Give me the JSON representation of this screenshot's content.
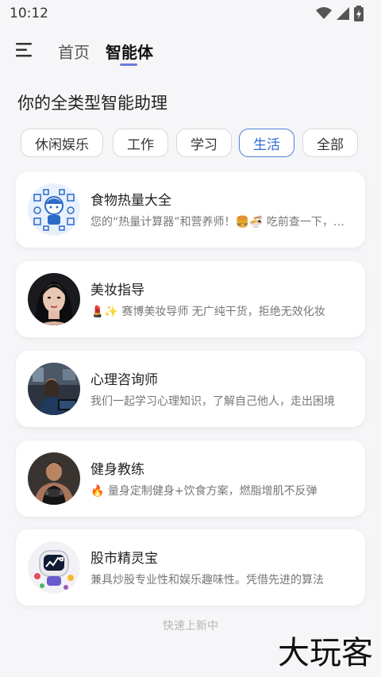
{
  "status_bar": {
    "time": "10:12"
  },
  "nav": {
    "tabs": [
      {
        "label": "首页"
      },
      {
        "label": "智能体"
      }
    ]
  },
  "headline": "你的全类型智能助理",
  "chips": [
    {
      "label": "休闲娱乐",
      "active": false
    },
    {
      "label": "工作",
      "active": false
    },
    {
      "label": "学习",
      "active": false
    },
    {
      "label": "生活",
      "active": true
    },
    {
      "label": "全部",
      "active": false
    }
  ],
  "cards": [
    {
      "title": "食物热量大全",
      "desc": "您的“热量计算器”和营养师！🍔🍜 吃前查一下，吃得更健康",
      "avatar_icon": "food-illustration-icon"
    },
    {
      "title": "美妆指导",
      "desc": "💄✨ 赛博美妆导师 无广纯干货，拒绝无效化妆",
      "avatar_icon": "woman-portrait-icon"
    },
    {
      "title": "心理咨询师",
      "desc": "我们一起学习心理知识，了解自己他人，走出困境",
      "avatar_icon": "therapist-portrait-icon"
    },
    {
      "title": "健身教练",
      "desc": "🔥 量身定制健身+饮食方案，燃脂增肌不反弹",
      "avatar_icon": "fitness-trainer-icon"
    },
    {
      "title": "股市精灵宝",
      "desc": "兼具炒股专业性和娱乐趣味性。凭借先进的算法",
      "avatar_icon": "stock-robot-icon"
    }
  ],
  "footer": {
    "loading_text": "快速上新中"
  },
  "watermark": "大玩客",
  "colors": {
    "accent": "#2e6ad6",
    "background": "#f6f6f8"
  }
}
